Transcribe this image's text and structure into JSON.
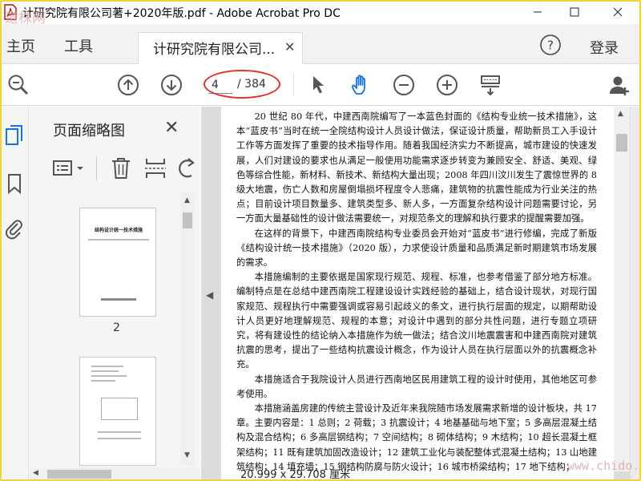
{
  "window": {
    "title": "计研究院有限公司著+2020年版.pdf - Adobe Acrobat Pro DC"
  },
  "menu": {
    "home": "主页",
    "tools": "工具",
    "document_tab": "计研究院有限公司...",
    "login": "登录"
  },
  "toolbar": {
    "current_page": "4",
    "total_pages": "/ 384"
  },
  "thumbnails": {
    "title": "页面缩略图",
    "page_number": "2",
    "cover_title": "结构设计统一技术措施"
  },
  "document": {
    "paragraphs": [
      "20 世纪 80 年代，中建西南院编写了一本蓝色封面的《结构专业统一技术措施》，这本“蓝皮书”当时在统一全院结构设计人员设计做法，保证设计质量，帮助新员工入手设计工作等方面发挥了重要的技术指导作用。随着我国经济实力不断提高，城市建设的快速发展，人们对建设的要求也从满足一般使用功能需求逐步转变为兼顾安全、舒适、美观、绿色等综合性能，新材料、新技术、新结构大量出现；2008 年四川汶川发生了震惊世界的 8 级大地震，伤亡人数和房屋倒塌损坏程度令人悲痛，建筑物的抗震性能成为行业关注的热点；目前设计项目数量多、建筑类型多、新人多，一方面复杂结构设计问题需要讨论，另一方面大量基础性的设计做法需要统一，对规范条文的理解和执行要求的提醒需要加强。",
      "在这样的背景下，中建西南院结构专业委员会开始对“蓝皮书”进行修编，完成了新版《结构设计统一技术措施》（2020 版），力求使设计质量和品质满足新时期建筑市场发展的需求。",
      "本措施编制的主要依据是国家现行规范、规程、标准，也参考借鉴了部分地方标准。编制特点是在总结中建西南院工程建设设计实践经验的基础上，结合设计现状，对现行国家规范、规程执行中需要强调或容易引起歧义的条文，进行执行层面的规定，以期帮助设计人员更好地理解规范、规程的本意；对设计中遇到的部分共性问题，进行专题立项研究，将有建设性的结论纳入本措施作为统一做法；结合汶川地震震害和中建西南院对建筑抗震的思考，提出了一些结构抗震设计概念，作为设计人员在执行层面以外的抗震概念补充。",
      "本措施适合于我院设计人员进行西南地区民用建筑工程的设计时使用，其他地区可参考使用。",
      "本措施涵盖房建的传统主营设计及近年来我院随市场发展需求新增的设计板块，共 17 章。主要内容是：1 总则；2 荷载；3 抗震设计；4 地基基础与地下室；5 多高层混凝土结构及混合结构；6 多高层钢结构；7 空间结构；8 砌体结构；9 木结构；10 超长混凝土框架结构；11 既有建筑加固改造设计；12 建筑工业化与装配整体式混凝土结构；13 山地建筑结构；14 填充墙；15 钢结构防腐与防火设计；16 城市桥梁结构；17 地下结构；"
    ],
    "page_size": "20.999 x 29.708 厘米"
  },
  "watermarks": {
    "top": "道株网",
    "bottom": "www.chido.com"
  },
  "colors": {
    "accent_blue": "#1473e6",
    "frame_yellow": "#f2d33a",
    "highlight_red": "#e03030"
  },
  "icons": [
    "acrobat-icon",
    "help-icon",
    "zoom-out-magnifier-icon",
    "page-up-icon",
    "page-down-icon",
    "select-arrow-icon",
    "hand-icon",
    "zoom-minus-icon",
    "zoom-plus-icon",
    "scroll-mode-icon",
    "share-person-icon",
    "thumbnails-icon",
    "bookmark-icon",
    "attachment-icon",
    "thumb-options-icon",
    "delete-icon",
    "extract-icon",
    "rotate-icon"
  ]
}
